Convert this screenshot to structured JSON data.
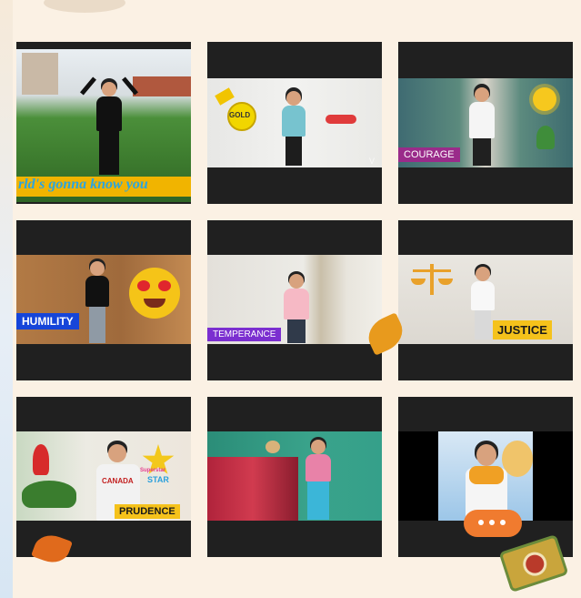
{
  "tiles": [
    {
      "caption": "rld's gonna know you"
    },
    {
      "badge": "GOLD"
    },
    {
      "label": "COURAGE"
    },
    {
      "label": "HUMILITY"
    },
    {
      "label": "TEMPERANCE"
    },
    {
      "label": "JUSTICE"
    },
    {
      "label": "PRUDENCE",
      "shirt": "CANADA",
      "sticker_line1": "Superstar",
      "sticker_line2": "STAR"
    },
    {},
    {}
  ],
  "watermark": "V",
  "colors": {
    "background": "#fbf1e4",
    "tile": "#202020"
  }
}
